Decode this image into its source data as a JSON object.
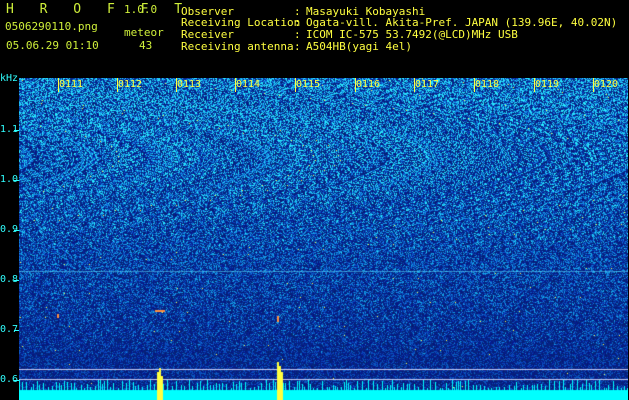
{
  "app": {
    "name_letters": "H R O F F T",
    "version": "1.0.0"
  },
  "file": {
    "name": "0506290110.png",
    "datetime": "05.06.29 01:10"
  },
  "meteor": {
    "label": "meteor",
    "count": "43"
  },
  "info": [
    {
      "label": "Observer",
      "sep": ":",
      "value": "Masayuki Kobayashi"
    },
    {
      "label": "Receiving Location",
      "sep": ":",
      "value": "Ogata-vill. Akita-Pref. JAPAN (139.96E, 40.02N)"
    },
    {
      "label": "Receiver",
      "sep": ":",
      "value": "ICOM IC-575 53.7492(@LCD)MHz USB"
    },
    {
      "label": "Receiving antenna",
      "sep": ":",
      "value": "A504HB(yagi 4el)"
    }
  ],
  "yaxis": {
    "unit": "kHz",
    "ticks": [
      "1.1",
      "1.0",
      "0.9",
      "0.8",
      "0.7",
      "0.6"
    ]
  },
  "time_labels": [
    "0111",
    "0112",
    "0113",
    "0114",
    "0115",
    "0116",
    "0117",
    "0118",
    "0119",
    "0120"
  ],
  "colors": {
    "header_text": "#cfef3a",
    "info_text": "#ffff40",
    "axis_text": "#30ffff",
    "spectrum_low": "#0a1a6e",
    "spectrum_high": "#20b8ff",
    "bottom_band": "#00ffff",
    "meteor_echo": "#ffff40"
  }
}
